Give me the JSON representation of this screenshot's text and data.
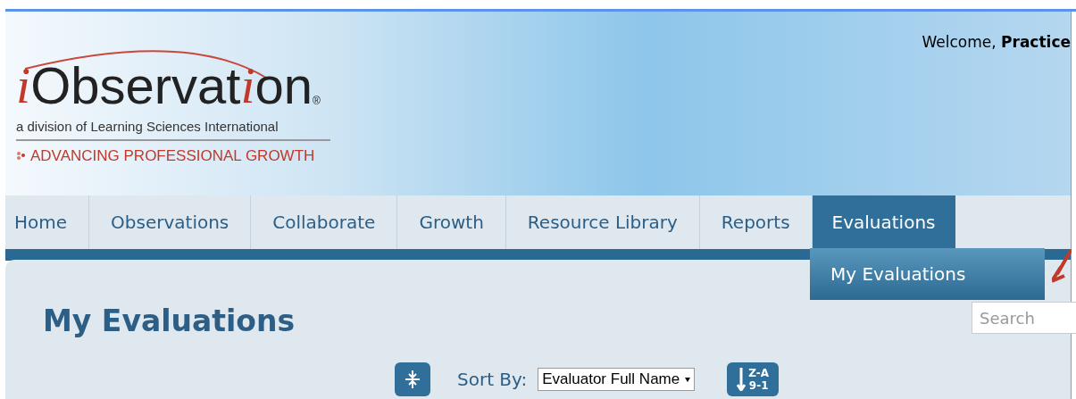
{
  "header": {
    "logo": {
      "name_start": "i",
      "name_middle": "Observat",
      "name_accent": "i",
      "name_end": "on",
      "registered": "®",
      "division": "a division of Learning Sciences International",
      "tagline": "ADVANCING PROFESSIONAL GROWTH"
    },
    "welcome": {
      "greeting": "Welcome,",
      "user": "Practice"
    }
  },
  "nav": [
    {
      "label": "Home",
      "selected": false
    },
    {
      "label": "Observations",
      "selected": false
    },
    {
      "label": "Collaborate",
      "selected": false
    },
    {
      "label": "Growth",
      "selected": false
    },
    {
      "label": "Resource Library",
      "selected": false
    },
    {
      "label": "Reports",
      "selected": false
    },
    {
      "label": "Evaluations",
      "selected": true
    }
  ],
  "dropdown": {
    "items": [
      "My Evaluations"
    ]
  },
  "page": {
    "title": "My Evaluations",
    "search": {
      "placeholder": "Search"
    },
    "sort_label": "Sort By:",
    "sort_value": "Evaluator Full Name",
    "sort_direction": {
      "top": "Z-A",
      "bottom": "9-1"
    }
  }
}
